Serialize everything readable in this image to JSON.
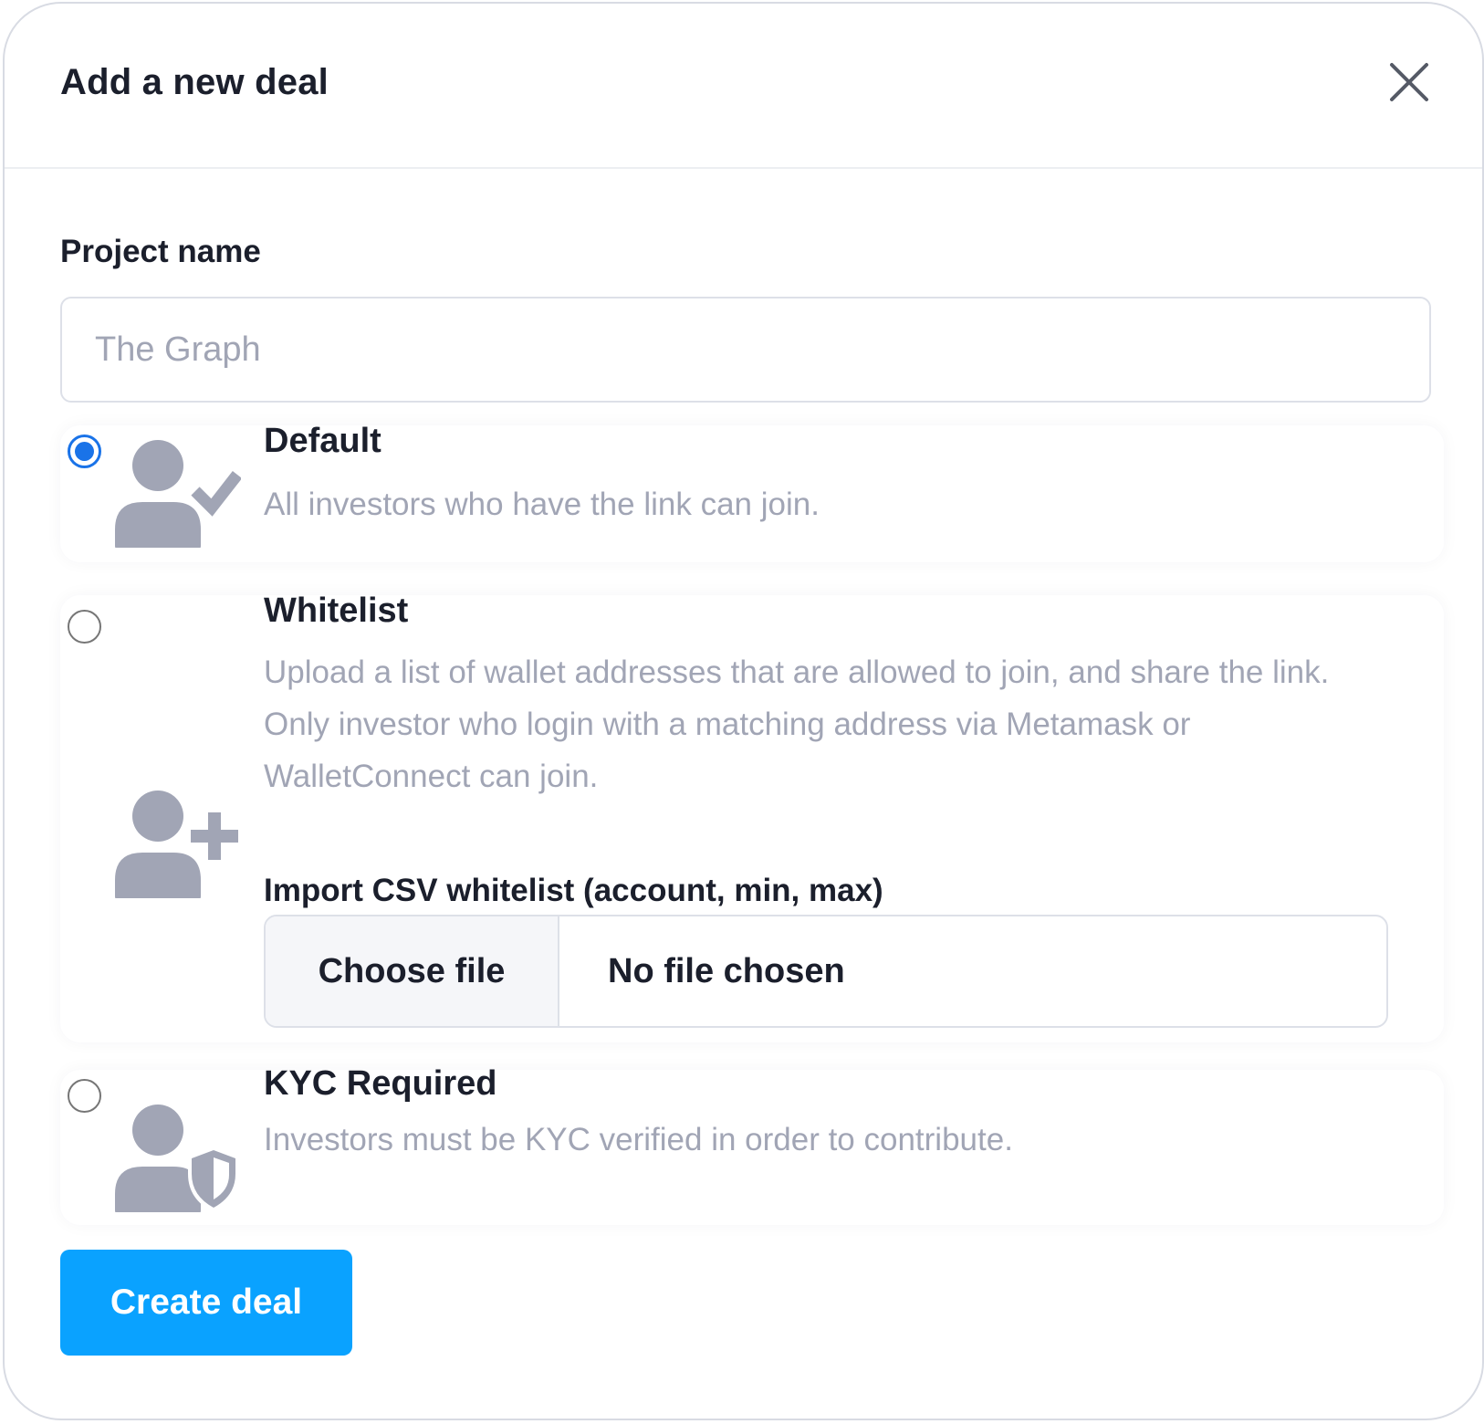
{
  "modal": {
    "title": "Add a new deal",
    "close_icon": "close-icon"
  },
  "project": {
    "label": "Project name",
    "value": "",
    "placeholder": "The Graph"
  },
  "options": [
    {
      "title": "Default",
      "description": "All investors who have the link can join.",
      "icon": "user-check-icon",
      "selected": true
    },
    {
      "title": "Whitelist",
      "description": "Upload a list of wallet addresses that are allowed to join, and share the link. Only investor who login with a matching address via Metamask or WalletConnect can join.",
      "icon": "user-plus-icon",
      "selected": false,
      "csv_label": "Import CSV whitelist (account, min, max)",
      "choose_file_label": "Choose file",
      "file_status": "No file chosen"
    },
    {
      "title": "KYC Required",
      "description": "Investors must be KYC verified in order to contribute.",
      "icon": "user-shield-icon",
      "selected": false
    }
  ],
  "actions": {
    "create_label": "Create deal"
  },
  "colors": {
    "accent": "#0aa2ff",
    "radio_checked": "#1a73e8",
    "icon_gray": "#a1a5b5",
    "text_dark": "#1b1f2c",
    "text_muted": "#a1a5b5"
  }
}
